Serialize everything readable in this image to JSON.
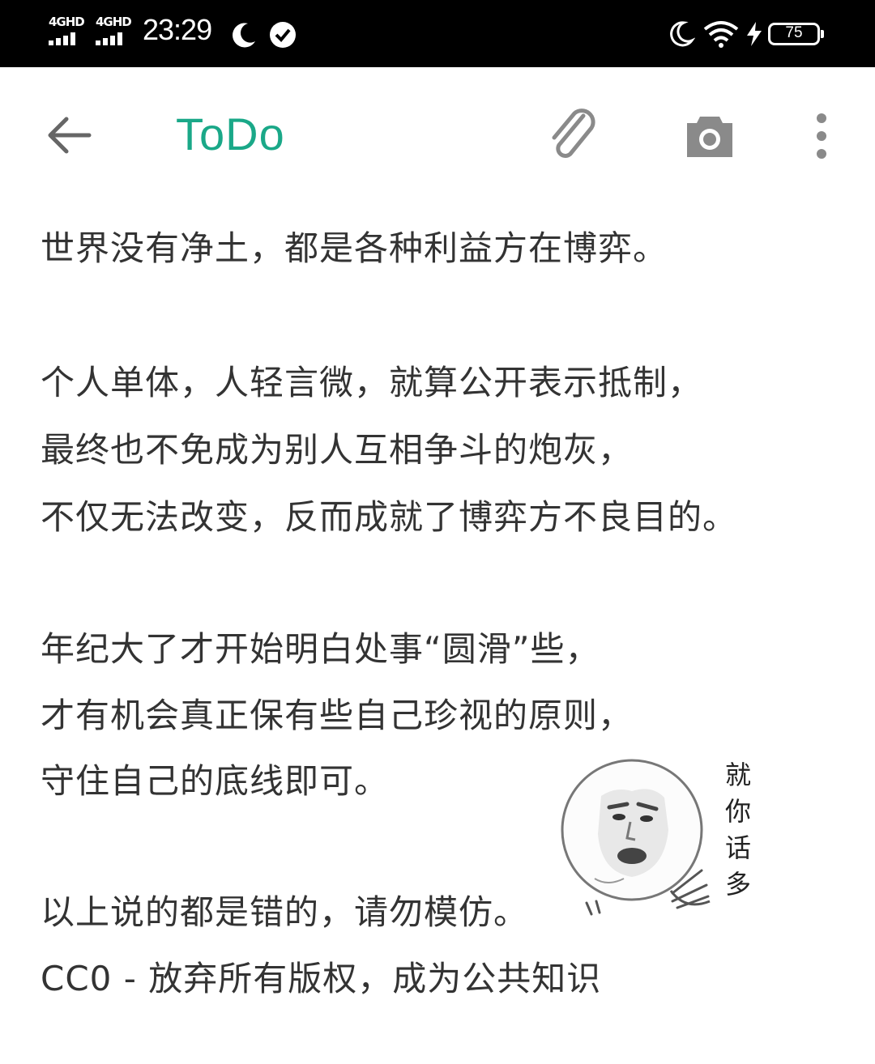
{
  "status_bar": {
    "network_1": "4GHD",
    "network_2": "4GHD",
    "time": "23:29",
    "battery_level": "75",
    "icons": [
      "signal-icon",
      "signal-icon",
      "moon-icon",
      "check-circle-icon",
      "moon-icon",
      "wifi-icon",
      "charging-icon",
      "battery-icon"
    ]
  },
  "app_bar": {
    "title": "ToDo",
    "title_color": "#1aa888",
    "icons": [
      "back-arrow-icon",
      "paperclip-icon",
      "camera-icon",
      "more-vert-icon"
    ]
  },
  "note": {
    "lines": [
      "世界没有净土，都是各种利益方在博弈。",
      "个人单体，人轻言微，就算公开表示抵制，",
      "最终也不免成为别人互相争斗的炮灰，",
      "不仅无法改变，反而成就了博弈方不良目的。",
      "年纪大了才开始明白处事“圆滑”些，",
      "才有机会真正保有些自己珍视的原则，",
      "守住自己的底线即可。",
      "以上说的都是错的，请勿模仿。",
      "CC0 - 放弃所有版权，成为公共知识"
    ]
  },
  "sticker": {
    "caption_chars": [
      "就",
      "你",
      "话",
      "多"
    ]
  }
}
